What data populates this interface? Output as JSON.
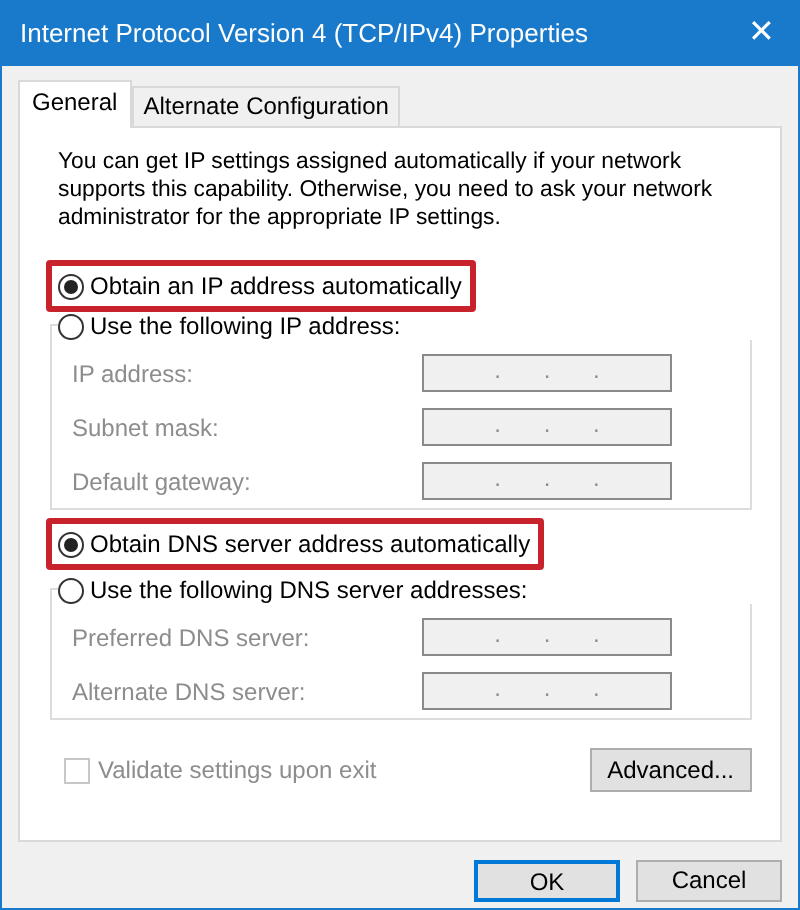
{
  "window": {
    "title": "Internet Protocol Version 4 (TCP/IPv4) Properties",
    "close": "✕"
  },
  "tabs": [
    {
      "label": "General",
      "selected": true
    },
    {
      "label": "Alternate Configuration",
      "selected": false
    }
  ],
  "intro": "You can get IP settings assigned automatically if your network supports this capability. Otherwise, you need to ask your network administrator for the appropriate IP settings.",
  "sections": [
    {
      "auto_option": {
        "label": "Obtain an IP address automatically",
        "selected": true,
        "highlighted": true
      },
      "manual_option": {
        "label": "Use the following IP address:",
        "selected": false
      },
      "fields": [
        {
          "label": "IP address:",
          "value": ". . .",
          "disabled": true
        },
        {
          "label": "Subnet mask:",
          "value": ". . .",
          "disabled": true
        },
        {
          "label": "Default gateway:",
          "value": ". . .",
          "disabled": true
        }
      ]
    },
    {
      "auto_option": {
        "label": "Obtain DNS server address automatically",
        "selected": true,
        "highlighted": true
      },
      "manual_option": {
        "label": "Use the following DNS server addresses:",
        "selected": false
      },
      "fields": [
        {
          "label": "Preferred DNS server:",
          "value": ". . .",
          "disabled": true
        },
        {
          "label": "Alternate DNS server:",
          "value": ". . .",
          "disabled": true
        }
      ]
    }
  ],
  "validate": {
    "label": "Validate settings upon exit",
    "checked": false,
    "disabled": true
  },
  "advanced_button": "Advanced...",
  "buttons": [
    {
      "label": "OK",
      "default": true
    },
    {
      "label": "Cancel",
      "default": false
    }
  ]
}
